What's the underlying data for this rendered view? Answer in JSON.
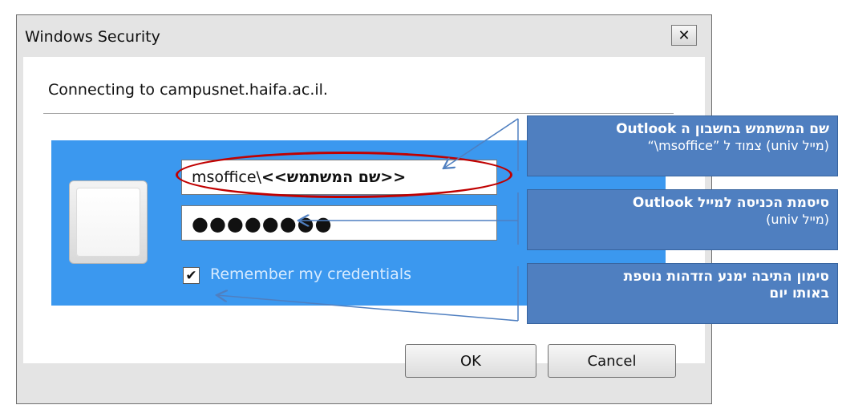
{
  "window": {
    "title": "Windows Security",
    "close_symbol": "✕"
  },
  "body": {
    "connecting_text": "Connecting to campusnet.haifa.ac.il.",
    "username": {
      "prefix": "msoffice\\",
      "placeholder_hint": "<<שם המשתמש>>"
    },
    "password_mask": "●●●●●●●●",
    "remember_label": "Remember my credentials",
    "remember_checked": true
  },
  "buttons": {
    "ok": "OK",
    "cancel": "Cancel"
  },
  "callouts": [
    {
      "line1": "שם המשתמש בחשבון ה Outlook",
      "line2": "(מייל univ) צמוד ל ”msoffice\\“"
    },
    {
      "line1": "סיסמת הכניסה למייל Outlook",
      "line2": "(מייל univ)"
    },
    {
      "line1": "סימון התיבה ימנע הזדהות נוספת",
      "line2": "באותו יום"
    }
  ],
  "colors": {
    "panel_blue": "#3b98ef",
    "callout_blue": "#4f7fc0",
    "highlight_red": "#c00000"
  }
}
